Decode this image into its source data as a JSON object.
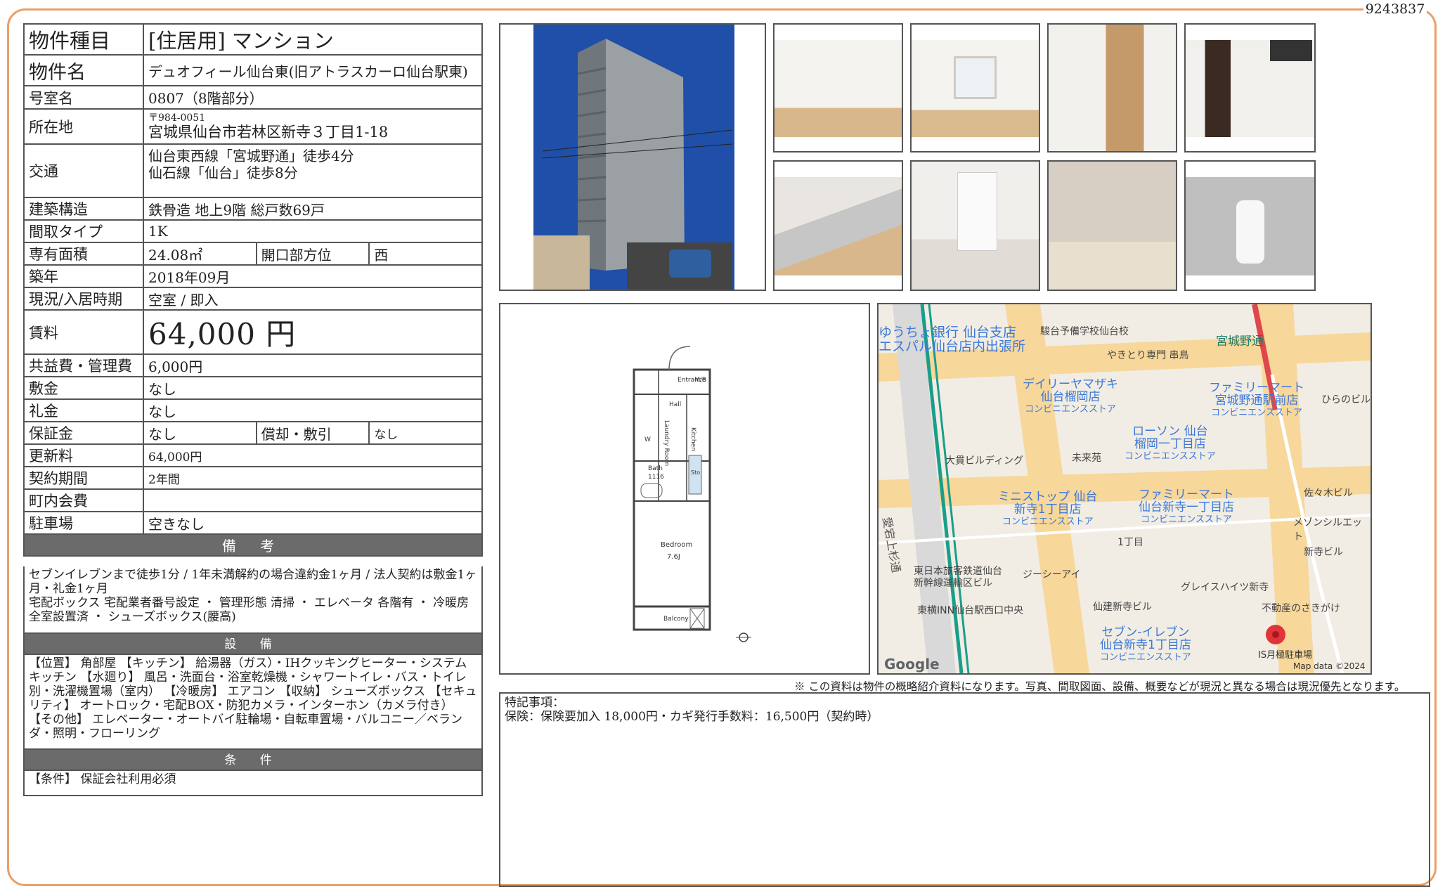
{
  "doc_id": "9243837",
  "rows": {
    "type": {
      "label": "物件種目",
      "value": "[住居用]  マンション"
    },
    "name": {
      "label": "物件名",
      "value": "デュオフィール仙台東(旧アトラスカーロ仙台駅東)"
    },
    "room": {
      "label": "号室名",
      "value": "0807（8階部分）"
    },
    "address": {
      "label": "所在地",
      "postal": "〒984-0051",
      "value": "宮城県仙台市若林区新寺３丁目1-18"
    },
    "access": {
      "label": "交通",
      "line1": "仙台東西線「宮城野通」徒歩4分",
      "line2": "仙石線「仙台」徒歩8分"
    },
    "structure": {
      "label": "建築構造",
      "value": "鉄骨造  地上9階  総戸数69戸"
    },
    "layout": {
      "label": "間取タイプ",
      "value": "1K"
    },
    "area": {
      "label": "専有面積",
      "value": "24.08㎡",
      "sub_label": "開口部方位",
      "sub_value": "西"
    },
    "built": {
      "label": "築年",
      "value": "2018年09月"
    },
    "status": {
      "label": "現況/入居時期",
      "value": "空室  /  即入"
    },
    "rent": {
      "label": "賃料",
      "value": "64,000 円"
    },
    "fee": {
      "label": "共益費・管理費",
      "value": "6,000円"
    },
    "deposit": {
      "label": "敷金",
      "value": "なし"
    },
    "key_money": {
      "label": "礼金",
      "value": "なし"
    },
    "guarantee": {
      "label": "保証金",
      "value": "なし",
      "sub_label": "償却・敷引",
      "sub_value": "なし"
    },
    "renewal": {
      "label": "更新料",
      "value": "64,000円"
    },
    "term": {
      "label": "契約期間",
      "value": "2年間"
    },
    "community": {
      "label": "町内会費",
      "value": ""
    },
    "parking": {
      "label": "駐車場",
      "value": "空きなし"
    }
  },
  "sections": {
    "remarks": {
      "title": "備 考",
      "text": "セブンイレブンまで徒歩1分 / 1年未満解約の場合違約金1ヶ月 / 法人契約は敷金1ヶ月・礼金1ヶ月\n宅配ボックス 宅配業者番号設定 ・ 管理形態 清掃 ・ エレベータ 各階有 ・ 冷暖房 全室設置済 ・ シューズボックス(腰高)"
    },
    "facilities": {
      "title": "設 備",
      "text": "【位置】 角部屋 【キッチン】 給湯器（ガス）・IHクッキングヒーター・システムキッチン 【水廻り】 風呂・洗面台・浴室乾燥機・シャワートイレ・バス・トイレ別・洗濯機置場（室内） 【冷暖房】 エアコン 【収納】 シューズボックス 【セキュリティ】 オートロック・宅配BOX・防犯カメラ・インターホン（カメラ付き） 【その他】 エレベーター・オートバイ駐輪場・自転車置場・バルコニー／ベランダ・照明・フローリング"
    },
    "conditions": {
      "title": "条 件",
      "text": "【条件】 保証会社利用必須"
    }
  },
  "floorplan": {
    "entrance": "Entrance",
    "mb": "M/B",
    "hall": "Hall",
    "kitchen": "Kitchen",
    "laundry": "Laundry Room",
    "w": "W",
    "bath": "Bath",
    "bath_size": "1116",
    "sto": "Sto",
    "bedroom": "Bedroom",
    "bedroom_size": "7.6J",
    "balcony": "Balcony"
  },
  "map": {
    "labels": [
      "ゆうちょ銀行 仙台支店",
      "エスパル仙台店内出張所",
      "駿台予備学校仙台校",
      "やきとり専門 串鳥",
      "宮城野通",
      "デイリーヤマザキ",
      "仙台榴岡店",
      "コンビニエンスストア",
      "ファミリーマート",
      "宮城野通駅前店",
      "ひらのビル",
      "ローソン 仙台",
      "榴岡一丁目店",
      "大貫ビルディング",
      "未来苑",
      "佐々木ビル",
      "ミニストップ 仙台",
      "新寺1丁目店",
      "ファミリーマート",
      "仙台新寺一丁目店",
      "メゾンシルエット",
      "1丁目",
      "新寺ビル",
      "東日本旅客鉄道仙台",
      "新幹線運輸区ビル",
      "ジーシーアイ",
      "グレイスハイツ新寺",
      "東横INN仙台駅西口中央",
      "仙建新寺ビル",
      "不動産のさきがけ",
      "セブン-イレブン",
      "仙台新寺1丁目店",
      "IS月極駐車場",
      "愛宕上杉通"
    ],
    "google": "Google",
    "copyright": "Map data ©2024"
  },
  "disclaimer": "※ この資料は物件の概略紹介資料になります。写真、間取図面、設備、概要などが現況と異なる場合は現況優先となります。",
  "special": {
    "title": "特記事項：",
    "text": "保険：保険要加入 18,000円・カギ発行手数料：16,500円（契約時）"
  },
  "colors": {
    "frame": "#e8a06a",
    "section_header": "#6b6b6b",
    "sky": "#1f4fa8",
    "building": "#9aa0a4",
    "floor_wood": "#d8b88a",
    "wall": "#f2f0ec"
  }
}
